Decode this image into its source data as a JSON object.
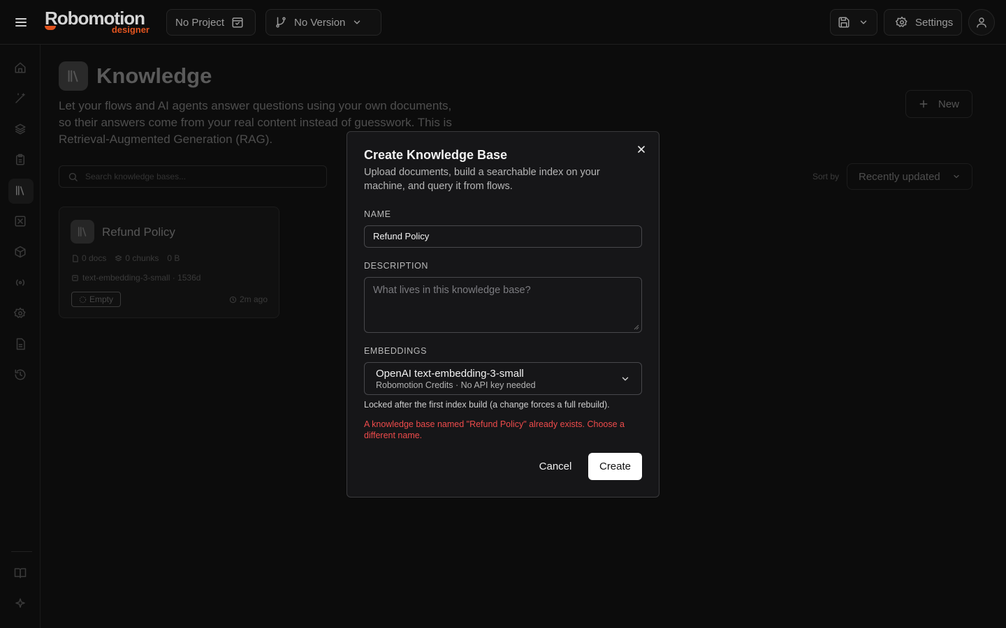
{
  "app": {
    "logo_text": "Robomotion",
    "logo_sub": "designer",
    "project_label": "No Project",
    "version_label": "No Version",
    "settings_label": "Settings"
  },
  "sidebar": {
    "items": [
      {
        "icon": "home-icon"
      },
      {
        "icon": "magic-wand-icon"
      },
      {
        "icon": "layers-icon"
      },
      {
        "icon": "clipboard-icon"
      },
      {
        "icon": "library-icon",
        "active": true
      },
      {
        "icon": "square-x-icon"
      },
      {
        "icon": "package-icon"
      },
      {
        "icon": "radio-icon"
      },
      {
        "icon": "gear-icon"
      },
      {
        "icon": "file-icon"
      },
      {
        "icon": "history-icon"
      }
    ],
    "bottom": [
      {
        "icon": "book-icon"
      },
      {
        "icon": "sparkle-icon"
      }
    ]
  },
  "page": {
    "title": "Knowledge",
    "description": "Let your flows and AI agents answer questions using your own documents, so their answers come from your real content instead of guesswork. This is Retrieval-Augmented Generation (RAG).",
    "new_button": "New",
    "search_placeholder": "Search knowledge bases...",
    "sort_label": "Sort by",
    "sort_value": "Recently updated"
  },
  "cards": [
    {
      "title": "Refund Policy",
      "docs": "0 docs",
      "chunks": "0 chunks",
      "size": "0 B",
      "model": "text-embedding-3-small · 1536d",
      "status": "Empty",
      "updated": "2m ago"
    }
  ],
  "modal": {
    "title": "Create Knowledge Base",
    "description": "Upload documents, build a searchable index on your machine, and query it from flows.",
    "name_label": "NAME",
    "name_value": "Refund Policy",
    "description_label": "DESCRIPTION",
    "description_placeholder": "What lives in this knowledge base?",
    "embeddings_label": "EMBEDDINGS",
    "embeddings_value": "OpenAI text-embedding-3-small",
    "embeddings_sub": "Robomotion Credits · No API key needed",
    "hint": "Locked after the first index build (a change forces a full rebuild).",
    "error": "A knowledge base named \"Refund Policy\" already exists. Choose a different name.",
    "cancel_label": "Cancel",
    "create_label": "Create",
    "error_color": "#ef4b4b"
  }
}
